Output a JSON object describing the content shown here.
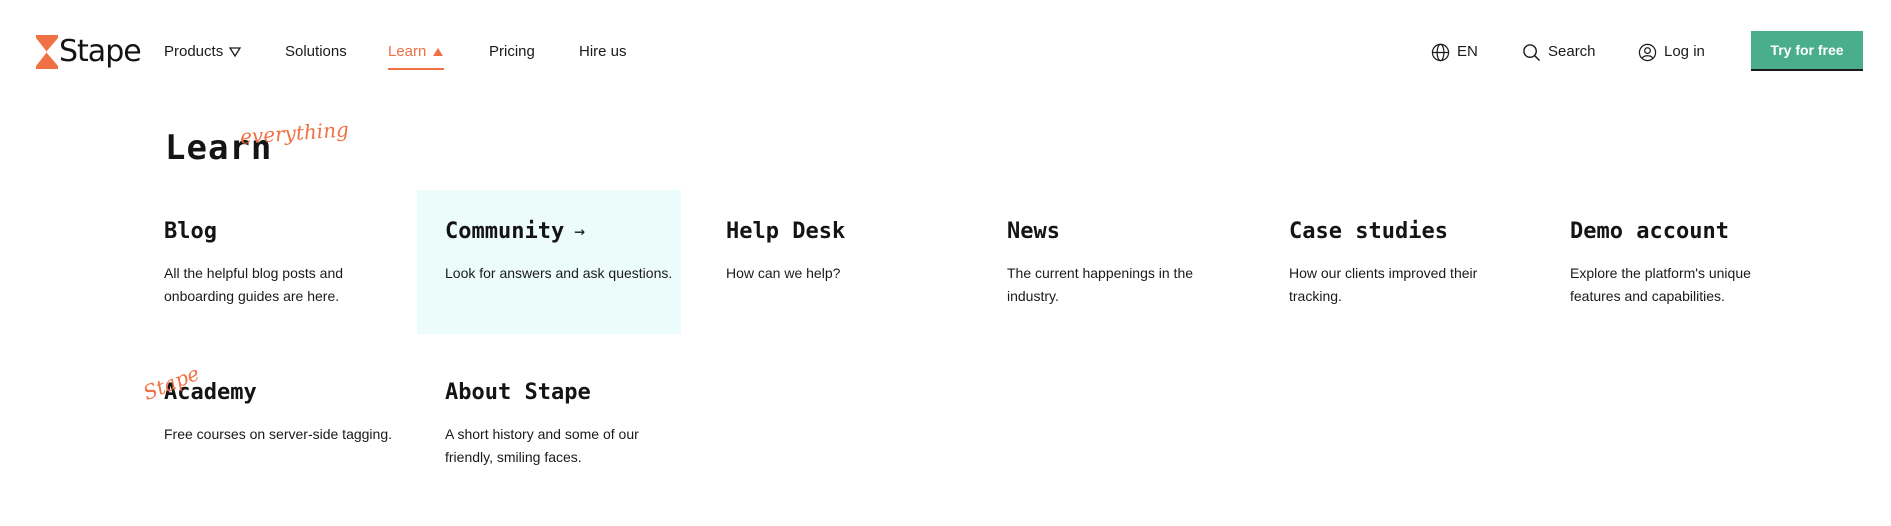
{
  "brand": {
    "name": "Stape",
    "accent": "#f07143",
    "cta_color": "#4aae8c"
  },
  "nav": {
    "items": [
      {
        "label": "Products"
      },
      {
        "label": "Solutions"
      },
      {
        "label": "Learn"
      },
      {
        "label": "Pricing"
      },
      {
        "label": "Hire us"
      }
    ]
  },
  "header_tools": {
    "language": "EN",
    "search": "Search",
    "login": "Log in",
    "cta": "Try for free"
  },
  "learn_menu": {
    "heading": "Learn",
    "heading_script": "everything",
    "academy_script": "Stape",
    "cards": [
      {
        "title": "Blog",
        "description": "All the helpful blog posts and onboarding guides are here."
      },
      {
        "title": "Community",
        "arrow": "→",
        "description": "Look for answers and ask questions."
      },
      {
        "title": "Help Desk",
        "description": "How can we help?"
      },
      {
        "title": "News",
        "description": "The current happenings in the industry."
      },
      {
        "title": "Case studies",
        "description": "How our clients improved their tracking."
      },
      {
        "title": "Demo account",
        "description": "Explore the platform's unique features and capabilities."
      },
      {
        "title": "Academy",
        "description": "Free courses on server-side tagging."
      },
      {
        "title": "About Stape",
        "description": "A short history and some of our friendly, smiling faces."
      }
    ]
  }
}
